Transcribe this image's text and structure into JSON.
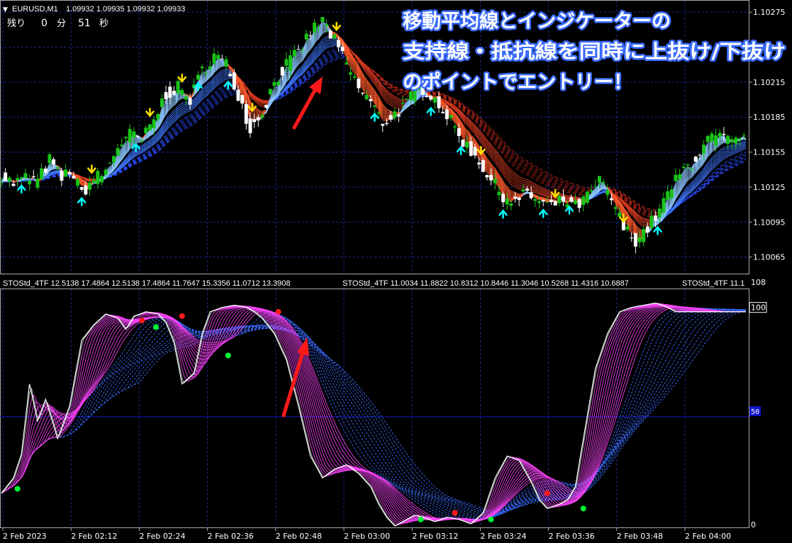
{
  "header": {
    "symbol": "EURUSD,M1",
    "quotes": "1.09932 1.09935 1.09932 1.09933",
    "timer_label": "残り",
    "timer_min": "0",
    "timer_min_unit": "分",
    "timer_sec": "51",
    "timer_sec_unit": "秒"
  },
  "annotation": {
    "line1": "移動平均線とインジケーターの",
    "line2": "支持線・抵抗線を同時に上抜け/下抜け",
    "line3": "のポイントでエントリー！",
    "color": "#3b6cff"
  },
  "subheader": {
    "text1": "STOStd_4TF 12.5138 17.4864 12.5138 17.4864 11.7647 15.3356 11.0712 13.3908",
    "text2": "STOStd_4TF 11.0034 11.8822 10.8312 10.8446 11.3046 10.5268 11.4316 10.6887",
    "text3": "STOStd_4TF 11.1"
  },
  "colors": {
    "bull": "#18c418",
    "bear": "#ffffff",
    "grid": "#1b2a8a",
    "sell_arrow": "#ffe000",
    "buy_arrow": "#00ffff",
    "stoch_fast": "#ff44ff",
    "stoch_slow": "#3a6bff",
    "stoch_main": "#ffffff",
    "level": "#1414c8",
    "signal_up": "#00ff33",
    "signal_down": "#ff1a1a",
    "pointer": "#ff1a1a"
  },
  "chart_data": [
    {
      "type": "candlestick",
      "price_axis_labels": [
        "1.10275",
        "1.10245",
        "1.10215",
        "1.10185",
        "1.10155",
        "1.10125",
        "1.10095",
        "1.10065"
      ],
      "ylim": [
        1.10052,
        1.10283
      ],
      "time_labels": [
        "2 Feb 2023",
        "2 Feb 02:12",
        "2 Feb 02:24",
        "2 Feb 02:36",
        "2 Feb 02:48",
        "2 Feb 03:00",
        "2 Feb 03:12",
        "2 Feb 03:24",
        "2 Feb 03:36",
        "2 Feb 03:48",
        "2 Feb 04:00"
      ],
      "close_path": [
        [
          0,
          1.10135
        ],
        [
          6,
          1.10128
        ],
        [
          12,
          1.10133
        ],
        [
          18,
          1.1013
        ],
        [
          24,
          1.10148
        ],
        [
          30,
          1.10132
        ],
        [
          34,
          1.1014
        ],
        [
          40,
          1.1012
        ],
        [
          46,
          1.10132
        ],
        [
          52,
          1.10138
        ],
        [
          58,
          1.1016
        ],
        [
          64,
          1.1017
        ],
        [
          70,
          1.10165
        ],
        [
          76,
          1.10182
        ],
        [
          82,
          1.10205
        ],
        [
          88,
          1.1021
        ],
        [
          94,
          1.102
        ],
        [
          100,
          1.10225
        ],
        [
          106,
          1.10238
        ],
        [
          112,
          1.1023
        ],
        [
          118,
          1.10205
        ],
        [
          124,
          1.10175
        ],
        [
          130,
          1.1019
        ],
        [
          136,
          1.10215
        ],
        [
          142,
          1.1023
        ],
        [
          148,
          1.1024
        ],
        [
          154,
          1.10258
        ],
        [
          160,
          1.10268
        ],
        [
          166,
          1.1025
        ],
        [
          172,
          1.1023
        ],
        [
          178,
          1.1021
        ],
        [
          184,
          1.10198
        ],
        [
          190,
          1.1018
        ],
        [
          196,
          1.10188
        ],
        [
          202,
          1.10196
        ],
        [
          208,
          1.10212
        ],
        [
          214,
          1.10205
        ],
        [
          220,
          1.10192
        ],
        [
          226,
          1.10175
        ],
        [
          232,
          1.1016
        ],
        [
          238,
          1.10148
        ],
        [
          244,
          1.1013
        ],
        [
          250,
          1.10118
        ],
        [
          256,
          1.10112
        ],
        [
          262,
          1.1012
        ],
        [
          268,
          1.10112
        ],
        [
          274,
          1.10108
        ],
        [
          280,
          1.10114
        ],
        [
          286,
          1.10108
        ],
        [
          292,
          1.10116
        ],
        [
          298,
          1.1013
        ],
        [
          304,
          1.10115
        ],
        [
          310,
          1.1009
        ],
        [
          316,
          1.1008
        ],
        [
          322,
          1.1009
        ],
        [
          328,
          1.10105
        ],
        [
          334,
          1.10125
        ],
        [
          340,
          1.1014
        ],
        [
          346,
          1.1015
        ],
        [
          352,
          1.10165
        ],
        [
          358,
          1.10168
        ],
        [
          364,
          1.10162
        ],
        [
          370,
          1.10165
        ]
      ],
      "sell_arrow_bars": [
        45,
        74,
        90,
        125,
        167,
        239,
        276,
        310
      ],
      "buy_arrow_bars": [
        10,
        40,
        67,
        98,
        113,
        186,
        214,
        229,
        250,
        270,
        283,
        327
      ],
      "ma_bands": 3
    },
    {
      "type": "line",
      "indicator": "STOStd_4TF",
      "axis_labels": [
        "108",
        "100",
        "50",
        "0"
      ],
      "ylim": [
        0,
        108
      ],
      "level": 50,
      "main_line": [
        [
          0,
          15
        ],
        [
          6,
          22
        ],
        [
          10,
          33
        ],
        [
          14,
          65
        ],
        [
          18,
          48
        ],
        [
          22,
          58
        ],
        [
          28,
          40
        ],
        [
          34,
          55
        ],
        [
          40,
          85
        ],
        [
          46,
          92
        ],
        [
          52,
          97
        ],
        [
          58,
          95
        ],
        [
          62,
          90
        ],
        [
          66,
          96
        ],
        [
          72,
          98
        ],
        [
          78,
          97
        ],
        [
          82,
          93
        ],
        [
          86,
          84
        ],
        [
          90,
          65
        ],
        [
          96,
          70
        ],
        [
          100,
          88
        ],
        [
          104,
          98
        ],
        [
          110,
          100
        ],
        [
          116,
          101
        ],
        [
          122,
          100
        ],
        [
          126,
          98
        ],
        [
          130,
          95
        ],
        [
          136,
          88
        ],
        [
          142,
          76
        ],
        [
          148,
          55
        ],
        [
          154,
          32
        ],
        [
          160,
          22
        ],
        [
          166,
          26
        ],
        [
          172,
          28
        ],
        [
          178,
          24
        ],
        [
          184,
          18
        ],
        [
          188,
          10
        ],
        [
          192,
          4
        ],
        [
          196,
          0
        ],
        [
          200,
          2
        ],
        [
          206,
          5
        ],
        [
          210,
          4
        ],
        [
          216,
          2
        ],
        [
          222,
          4
        ],
        [
          228,
          3
        ],
        [
          234,
          1
        ],
        [
          240,
          6
        ],
        [
          246,
          22
        ],
        [
          252,
          32
        ],
        [
          258,
          30
        ],
        [
          264,
          20
        ],
        [
          268,
          12
        ],
        [
          272,
          8
        ],
        [
          278,
          10
        ],
        [
          282,
          12
        ],
        [
          286,
          18
        ],
        [
          290,
          40
        ],
        [
          296,
          72
        ],
        [
          302,
          88
        ],
        [
          308,
          98
        ],
        [
          314,
          100
        ],
        [
          320,
          101
        ],
        [
          326,
          102
        ],
        [
          332,
          100
        ],
        [
          336,
          98
        ]
      ],
      "signal_down_points": [
        [
          70,
          94
        ],
        [
          90,
          96
        ],
        [
          138,
          98
        ],
        [
          226,
          6
        ],
        [
          272,
          15
        ]
      ],
      "signal_up_points": [
        [
          8,
          17
        ],
        [
          77,
          91
        ],
        [
          113,
          78
        ],
        [
          209,
          3
        ],
        [
          244,
          3
        ],
        [
          290,
          8
        ]
      ]
    }
  ]
}
